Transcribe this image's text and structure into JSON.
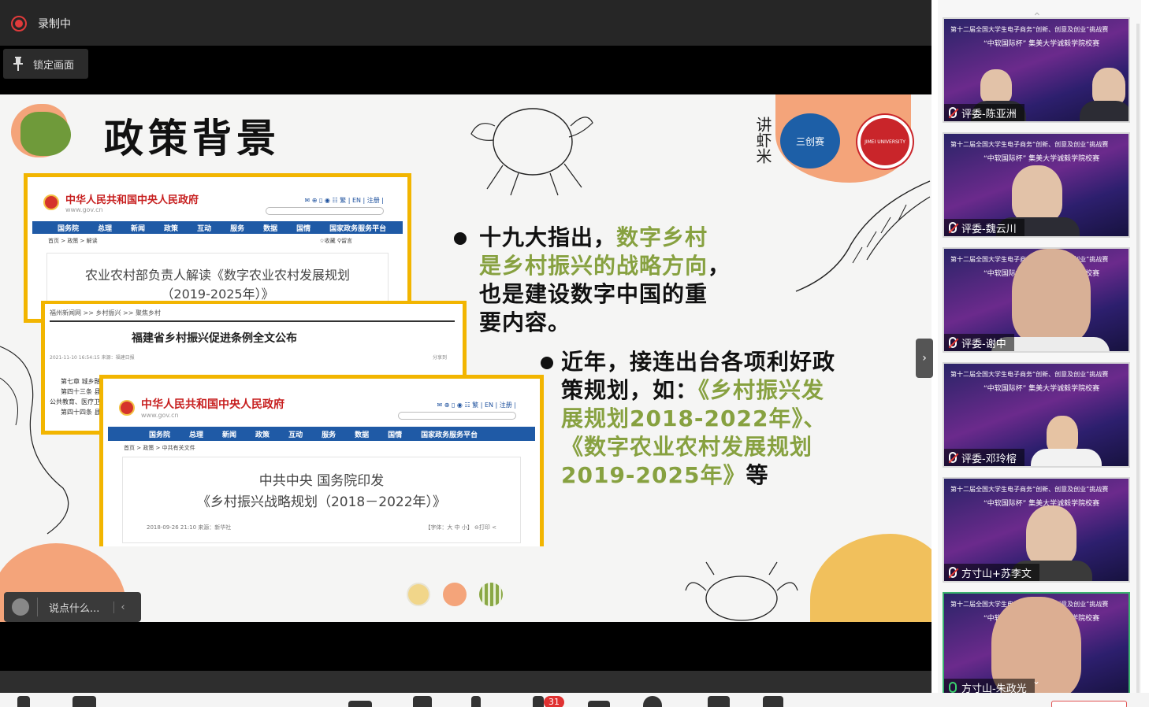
{
  "recording": {
    "label": "录制中"
  },
  "lock": {
    "label": "锁定画面"
  },
  "slide": {
    "title": "政策背景",
    "logos": {
      "shrimp_logo_text": "讲虾米",
      "badge_text": "三创赛",
      "university_text": "JIMEI UNIVERSITY"
    },
    "screenshot1": {
      "site": "中华人民共和国中央人民政府",
      "url": "www.gov.cn",
      "links": "✉ ⊕ ▯ ◉ ☷ 繁 | EN | 注册 |",
      "nav": [
        "国务院",
        "总理",
        "新闻",
        "政策",
        "互动",
        "服务",
        "数据",
        "国情",
        "国家政务服务平台"
      ],
      "crumbs": "首页 > 政策 > 解读",
      "share": "☆收藏  ⚲留言",
      "doc_title_1": "农业农村部负责人解读《数字农业农村发展规划",
      "doc_title_2": "（2019-2025年）》"
    },
    "screenshot2": {
      "crumbs": "福州新闻网 >> 乡村振兴 >> 聚焦乡村",
      "doc_title": "福建省乡村振兴促进条例全文公布",
      "meta": "2021-11-10 16:54:15    来源：福建日报",
      "share": "分享到",
      "lines": [
        "第七章 城乡融合",
        "第四十三条 县",
        "公共教育、医疗卫生",
        "第四十四条 县"
      ]
    },
    "screenshot3": {
      "site": "中华人民共和国中央人民政府",
      "url": "www.gov.cn",
      "links": "✉ ⊕ ▯ ◉ ☷ 繁 | EN | 注册 |",
      "nav": [
        "国务院",
        "总理",
        "新闻",
        "政策",
        "互动",
        "服务",
        "数据",
        "国情",
        "国家政务服务平台"
      ],
      "crumbs": "首页 > 政策 > 中共有关文件",
      "doc_title_1": "中共中央 国务院印发",
      "doc_title_2": "《乡村振兴战略规划（2018－2022年）》",
      "meta": "2018-09-26 21:10    来源：新华社",
      "font_size": "【字体：大 中 小】  ⊖打印  <"
    },
    "bullet1": {
      "line1_black": "十九大指出，",
      "line1_green": "数字乡村",
      "line2_green": "是乡村振兴的战略方向",
      "line2_black": "，",
      "line3": "也是建设数字中国的重",
      "line4": "要内容。"
    },
    "bullet2": {
      "line1": "近年，接连出台各项利好政",
      "line2_black": "策规划，如：",
      "line2_green": "《乡村振兴发",
      "line3": "展规划2018-2022年》、",
      "line4": "《数字农业农村发展规划",
      "line5_green": "2019-2025年》",
      "line5_black": "等"
    }
  },
  "chat": {
    "placeholder": "说点什么..."
  },
  "banner": {
    "line1": "第十二届全国大学生电子商务“创新、创意及创业”挑战赛",
    "line2": "“中软国际杯” 集美大学诚毅学院校赛"
  },
  "participants": [
    {
      "name": "评委-陈亚洲",
      "mic": "muted"
    },
    {
      "name": "评委-魏云川",
      "mic": "muted"
    },
    {
      "name": "评委-谢中",
      "mic": "muted"
    },
    {
      "name": "评委-邓玲榕",
      "mic": "muted"
    },
    {
      "name": "方寸山+苏李文",
      "mic": "muted"
    },
    {
      "name": "方寸山-朱政光",
      "mic": "on"
    }
  ],
  "toolbar": {
    "badge_count": "31"
  },
  "colors": {
    "accent_green": "#87a140",
    "gov_red": "#c71f1f",
    "frame_yellow": "#f2b500",
    "blob_orange": "#f4a47a",
    "blob_yellow": "#f1c05c"
  }
}
